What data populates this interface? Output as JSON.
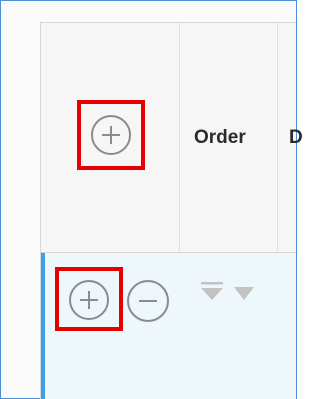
{
  "grid": {
    "columns": [
      {
        "id": "actions",
        "label": ""
      },
      {
        "id": "order",
        "label": "Order"
      },
      {
        "id": "next",
        "label": "D"
      }
    ],
    "header": {
      "add_button_icon": "plus-circle-icon",
      "add_button_highlighted": true
    },
    "row": {
      "add_button_icon": "plus-circle-icon",
      "add_button_highlighted": true,
      "remove_button_icon": "minus-circle-icon",
      "order_controls": [
        "sort-top-icon",
        "sort-down-icon"
      ]
    }
  },
  "colors": {
    "highlight": "#e60000",
    "row_background": "#eef7fc",
    "row_indicator": "#3aa0e8",
    "frame_border": "#4a90d9"
  }
}
